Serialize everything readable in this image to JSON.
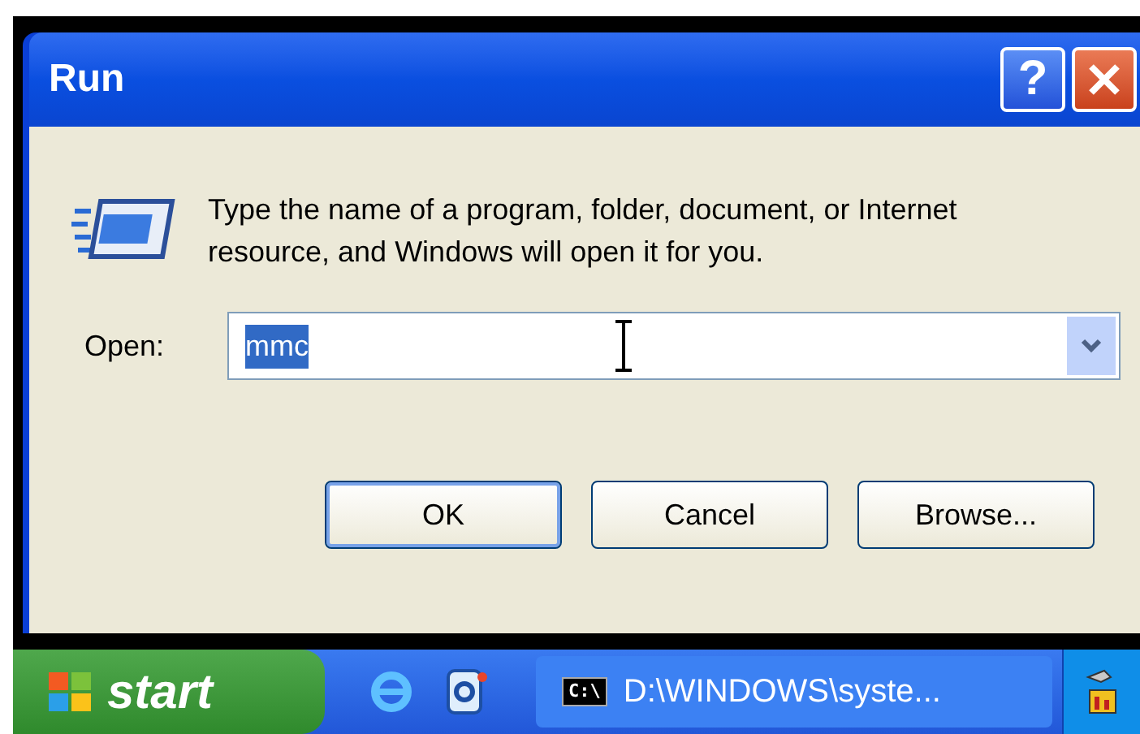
{
  "window": {
    "title": "Run",
    "title_buttons": [
      {
        "kind": "help",
        "label": "?"
      },
      {
        "kind": "close"
      }
    ]
  },
  "message": "Type the name of a program, folder, document, or Internet resource, and Windows will open it for you.",
  "open_field": {
    "label": "Open:",
    "value": "mmc",
    "value_selected": true
  },
  "buttons": [
    {
      "label": "OK",
      "default": true
    },
    {
      "label": "Cancel",
      "default": false
    },
    {
      "label": "Browse...",
      "default": false
    }
  ],
  "taskbar": {
    "start": "start",
    "quick_launch": [
      {
        "kind": "browser"
      },
      {
        "kind": "outlook"
      }
    ],
    "tasks": [
      {
        "label": "D:\\WINDOWS\\syste...",
        "icon_text": "C:\\",
        "selected": false
      }
    ]
  }
}
